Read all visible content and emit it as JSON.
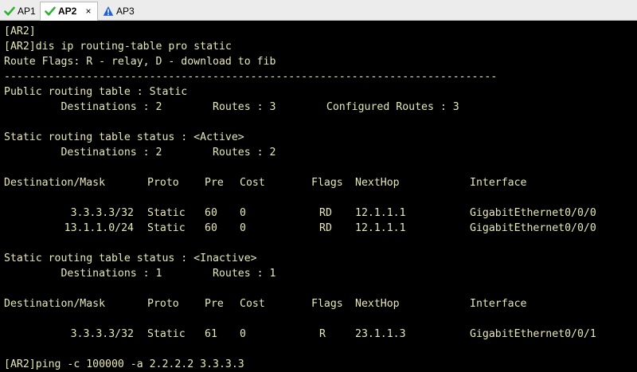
{
  "tabs": [
    {
      "label": "AP1",
      "icon": "check-icon",
      "active": false
    },
    {
      "label": "AP2",
      "icon": "check-icon",
      "active": true,
      "close": "×"
    },
    {
      "label": "AP3",
      "icon": "warning-icon",
      "active": false
    }
  ],
  "colors": {
    "terminal_bg": "#000000",
    "text": "#e7e7b8",
    "check_green": "#2fb12f",
    "warning_blue": "#1e5fd6"
  },
  "terminal": {
    "l1": "[AR2]",
    "l2": "[AR2]dis ip routing-table pro static",
    "l3": "Route Flags: R - relay, D - download to fib",
    "l4": "------------------------------------------------------------------------------",
    "l5": "Public routing table : Static",
    "l6": "         Destinations : 2        Routes : 3        Configured Routes : 3",
    "l8": "Static routing table status : <Active>",
    "l9": "         Destinations : 2        Routes : 2",
    "header": [
      "Destination/Mask",
      "Proto",
      "Pre",
      "Cost",
      "Flags",
      "NextHop",
      "Interface"
    ],
    "active_rows": [
      [
        "3.3.3.3/32",
        "Static",
        "60",
        "0",
        "RD",
        "12.1.1.1",
        "GigabitEthernet0/0/0"
      ],
      [
        "13.1.1.0/24",
        "Static",
        "60",
        "0",
        "RD",
        "12.1.1.1",
        "GigabitEthernet0/0/0"
      ]
    ],
    "l16": "Static routing table status : <Inactive>",
    "l17": "         Destinations : 1        Routes : 1",
    "header2": [
      "Destination/Mask",
      "Proto",
      "Pre",
      "Cost",
      "Flags",
      "NextHop",
      "Interface"
    ],
    "inactive_rows": [
      [
        "3.3.3.3/32",
        "Static",
        "61",
        "0",
        "R",
        "23.1.1.3",
        "GigabitEthernet0/0/1"
      ]
    ],
    "prompt": "[AR2]ping -c 100000 -a 2.2.2.2 3.3.3.3"
  }
}
